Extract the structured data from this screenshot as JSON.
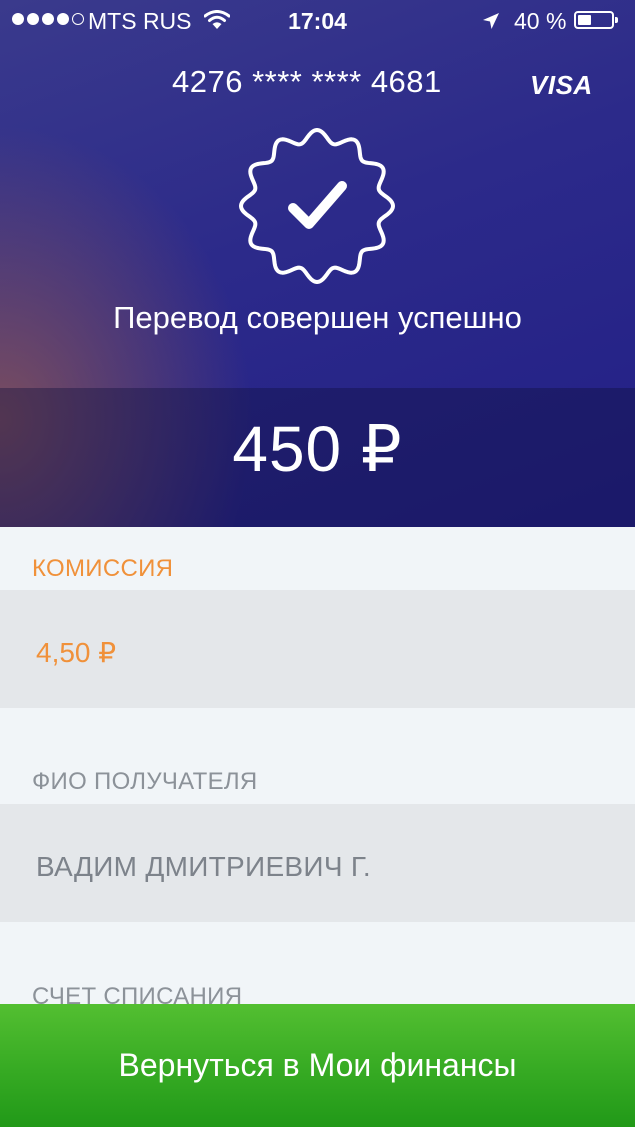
{
  "status_bar": {
    "carrier": "MTS RUS",
    "time": "17:04",
    "battery": "40 %",
    "battery_level": 0.4,
    "signal_bars": 4,
    "icons": [
      "wifi-icon",
      "location-arrow-icon",
      "battery-icon"
    ]
  },
  "header": {
    "card_number": "4276 **** **** 4681",
    "card_brand": "VISA",
    "success_icon": "check-badge-icon",
    "success_message": "Перевод совершен успешно",
    "amount": "450 ₽"
  },
  "details": {
    "commission": {
      "label": "КОМИССИЯ",
      "value": "4,50 ₽"
    },
    "recipient": {
      "label": "ФИО ПОЛУЧАТЕЛЯ",
      "value": "ВАДИМ ДМИТРИЕВИЧ Г."
    },
    "debit_account": {
      "label": "СЧЕТ СПИСАНИЯ"
    }
  },
  "footer": {
    "button_label": "Вернуться в Мои финансы"
  },
  "colors": {
    "header_start": "#3a3a8c",
    "header_end": "#221f86",
    "accent_orange": "#f0913a",
    "button_green": "#36aa23",
    "row_gray": "#e4e7ea",
    "page_bg": "#f1f5f8"
  }
}
